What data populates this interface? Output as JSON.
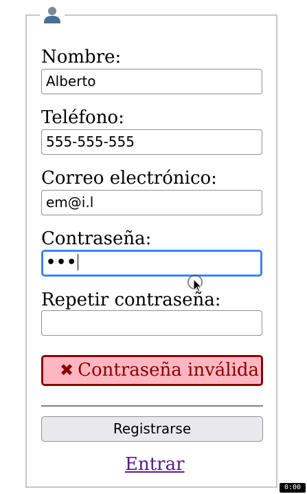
{
  "form": {
    "legend_icon": "user-icon",
    "fields": [
      {
        "label": "Nombre:",
        "value": "Alberto",
        "placeholder": ""
      },
      {
        "label": "Teléfono:",
        "value": "555-555-555",
        "placeholder": ""
      },
      {
        "label": "Correo electrónico:",
        "value": "em@i.l",
        "placeholder": ""
      },
      {
        "label": "Contraseña:",
        "value": "•••",
        "placeholder": ""
      },
      {
        "label": "Repetir contraseña:",
        "value": "",
        "placeholder": ""
      }
    ],
    "error": {
      "icon": "✖",
      "text": "Contraseña inválida"
    },
    "submit_label": "Registrarse",
    "login_link": "Entrar"
  },
  "overlay": {
    "timer": "0:00"
  },
  "colors": {
    "focus_border": "#3b82f6",
    "error_border": "#8b0000",
    "error_background": "#ffb6c1",
    "link": "#551a8b"
  }
}
